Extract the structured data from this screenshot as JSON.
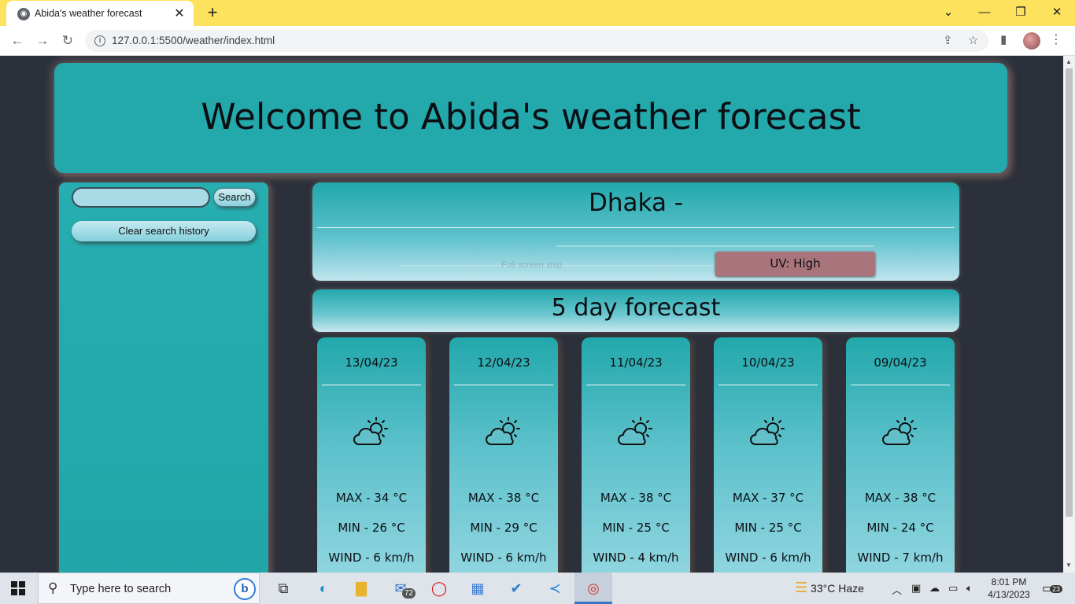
{
  "browser": {
    "tab_title": "Abida's weather forecast",
    "url": "127.0.0.1:5500/weather/index.html"
  },
  "page": {
    "header_title": "Welcome to Abida's weather forecast",
    "sidebar": {
      "search_value": "",
      "search_button": "Search",
      "clear_button": "Clear search history"
    },
    "current": {
      "city": "Dhaka  -",
      "ghost_text": "Full screen snip",
      "uv_label": "UV: High",
      "uv_color": "#a9747c"
    },
    "forecast_title": "5 day forecast",
    "forecast": [
      {
        "date": "13/04/23",
        "icon": "partly-cloudy-icon",
        "max": "MAX - 34 °C",
        "min": "MIN - 26 °C",
        "wind": "WIND - 6 km/h"
      },
      {
        "date": "12/04/23",
        "icon": "partly-cloudy-icon",
        "max": "MAX - 38 °C",
        "min": "MIN - 29 °C",
        "wind": "WIND - 6 km/h"
      },
      {
        "date": "11/04/23",
        "icon": "partly-cloudy-icon",
        "max": "MAX - 38 °C",
        "min": "MIN - 25 °C",
        "wind": "WIND - 4 km/h"
      },
      {
        "date": "10/04/23",
        "icon": "partly-cloudy-icon",
        "max": "MAX - 37 °C",
        "min": "MIN - 25 °C",
        "wind": "WIND - 6 km/h"
      },
      {
        "date": "09/04/23",
        "icon": "partly-cloudy-icon",
        "max": "MAX - 38 °C",
        "min": "MIN - 24 °C",
        "wind": "WIND - 7 km/h"
      }
    ]
  },
  "taskbar": {
    "search_placeholder": "Type here to search",
    "mail_badge": "72",
    "weather": "33°C  Haze",
    "time": "8:01 PM",
    "date": "4/13/2023",
    "notification_count": "23"
  },
  "colors": {
    "tabbar": "#fde25d",
    "accent": "#23a8ab",
    "page_bg": "#2b303a"
  }
}
